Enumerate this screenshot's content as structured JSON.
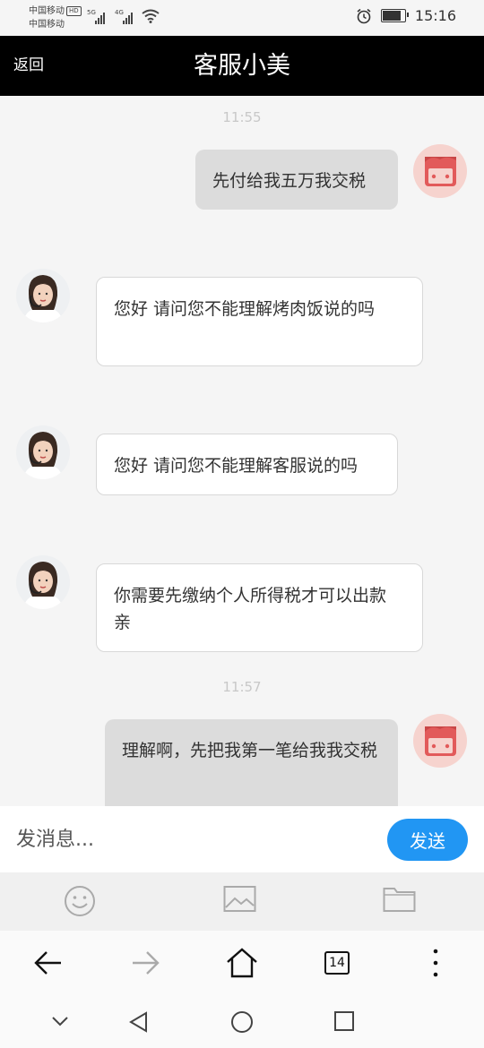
{
  "status_bar": {
    "carrier_1": "中国移动",
    "hd_badge": "HD",
    "carrier_2": "中国移动",
    "net_1": "5G",
    "net_2": "4G",
    "time": "15:16",
    "icons": [
      "signal-icon",
      "wifi-icon",
      "alarm-icon",
      "battery-icon"
    ]
  },
  "header": {
    "back_label": "返回",
    "title": "客服小美"
  },
  "chat": {
    "timestamps": [
      "11:55",
      "11:57"
    ],
    "messages": [
      {
        "side": "out",
        "text": "先付给我五万我交税"
      },
      {
        "side": "in",
        "text": "您好   请问您不能理解烤肉饭说的吗"
      },
      {
        "side": "in",
        "text": "您好 请问您不能理解客服说的吗"
      },
      {
        "side": "in",
        "text": "你需要先缴纳个人所得税才可以出款   亲"
      },
      {
        "side": "out",
        "text": "理解啊，先把我第一笔给我我交税"
      }
    ]
  },
  "composer": {
    "placeholder": "发消息...",
    "send_label": "发送"
  },
  "toolbar": {
    "icons": [
      "emoji-icon",
      "image-icon",
      "folder-icon"
    ]
  },
  "browser": {
    "tab_count": "14",
    "icons": [
      "back-arrow-icon",
      "forward-arrow-icon",
      "home-icon",
      "tabs-icon",
      "more-icon"
    ]
  },
  "system_nav": {
    "icons": [
      "collapse-icon",
      "back-triangle-icon",
      "home-circle-icon",
      "recents-square-icon"
    ]
  },
  "colors": {
    "header_bg": "#000000",
    "send_button": "#2196f3",
    "outgoing_bubble": "#dcdcdc",
    "incoming_bubble": "#ffffff",
    "user_avatar": "#e25a5a"
  }
}
